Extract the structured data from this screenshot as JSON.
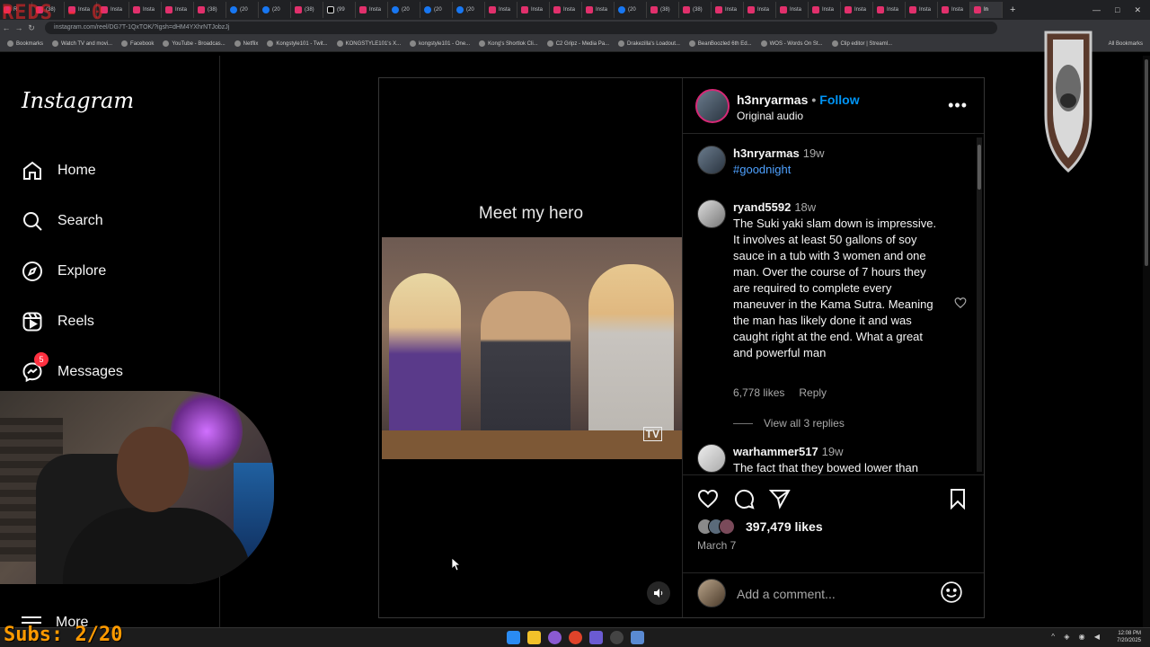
{
  "browser": {
    "tabs": [
      {
        "label": "R",
        "kind": "ig"
      },
      {
        "label": "(38)",
        "kind": "ig"
      },
      {
        "label": "Insta",
        "kind": "ig"
      },
      {
        "label": "Insta",
        "kind": "ig"
      },
      {
        "label": "Insta",
        "kind": "ig"
      },
      {
        "label": "Insta",
        "kind": "ig"
      },
      {
        "label": "(38)",
        "kind": "ig"
      },
      {
        "label": "(20",
        "kind": "fb"
      },
      {
        "label": "(20",
        "kind": "fb"
      },
      {
        "label": "(38)",
        "kind": "ig"
      },
      {
        "label": "(99",
        "kind": "tt"
      },
      {
        "label": "Insta",
        "kind": "ig"
      },
      {
        "label": "(20",
        "kind": "fb"
      },
      {
        "label": "(20",
        "kind": "fb"
      },
      {
        "label": "(20",
        "kind": "fb"
      },
      {
        "label": "Insta",
        "kind": "ig"
      },
      {
        "label": "Insta",
        "kind": "ig"
      },
      {
        "label": "Insta",
        "kind": "ig"
      },
      {
        "label": "Insta",
        "kind": "ig"
      },
      {
        "label": "(20",
        "kind": "fb"
      },
      {
        "label": "(38)",
        "kind": "ig"
      },
      {
        "label": "(38)",
        "kind": "ig"
      },
      {
        "label": "Insta",
        "kind": "ig"
      },
      {
        "label": "Insta",
        "kind": "ig"
      },
      {
        "label": "Insta",
        "kind": "ig"
      },
      {
        "label": "Insta",
        "kind": "ig"
      },
      {
        "label": "Insta",
        "kind": "ig"
      },
      {
        "label": "Insta",
        "kind": "ig"
      },
      {
        "label": "Insta",
        "kind": "ig"
      },
      {
        "label": "Insta",
        "kind": "ig"
      },
      {
        "label": "In",
        "kind": "active"
      }
    ],
    "new_tab": "+",
    "url": "instagram.com/reel/DG7T-1QxTOK/?igsh=dHM4YXhrNTJobzJj",
    "bookmarks": [
      "Bookmarks",
      "Watch TV and movi...",
      "Facebook",
      "YouTube - Broadcas...",
      "Netflix",
      "Kongstyle101 - Twit...",
      "KONGSTYLE101's X...",
      "kongstyle101 - One...",
      "Kong's Shortlok Cli...",
      "C2 Gripz - Media Pa...",
      "Drakezilla's Loadout...",
      "BeanBoozled 6th Ed...",
      "WOS - Words On St...",
      "Clip editor | Streaml..."
    ],
    "all_bookmarks": "All Bookmarks"
  },
  "sidebar": {
    "logo": "Instagram",
    "items": [
      {
        "label": "Home",
        "icon": "home-icon"
      },
      {
        "label": "Search",
        "icon": "search-icon"
      },
      {
        "label": "Explore",
        "icon": "compass-icon"
      },
      {
        "label": "Reels",
        "icon": "reels-icon"
      },
      {
        "label": "Messages",
        "icon": "messenger-icon",
        "badge": "5"
      }
    ],
    "more": "More"
  },
  "post": {
    "video_caption": "Meet my hero",
    "tv_logo": "TV",
    "author": "h3nryarmas",
    "dot": "•",
    "follow": "Follow",
    "audio": "Original audio",
    "comments": [
      {
        "user": "h3nryarmas",
        "time": "19w",
        "text": "#goodnight",
        "is_tag": true
      },
      {
        "user": "ryand5592",
        "time": "18w",
        "text": "The Suki yaki slam down is impressive. It involves at least 50 gallons of soy sauce in a tub with 3 women and one man. Over the course of 7 hours they are required to complete every maneuver in the Kama Sutra. Meaning the man has likely done it and was caught right at the end. What a great and powerful man",
        "likes": "6,778 likes",
        "reply": "Reply",
        "view_replies": "View all 3 replies"
      },
      {
        "user": "warhammer517",
        "time": "19w",
        "text": "The fact that they bowed lower than"
      }
    ],
    "likes": "397,479 likes",
    "date": "March 7",
    "comment_placeholder": "Add a comment..."
  },
  "overlays": {
    "top_text": "REDS - 0",
    "subs": "Subs: 2/20"
  },
  "taskbar": {
    "time": "12:08 PM",
    "date": "7/20/2025"
  },
  "colors": {
    "accent": "#0095f6",
    "badge": "#ff3040",
    "tag": "#4ea1ff",
    "subs_overlay": "#ff9a00"
  }
}
